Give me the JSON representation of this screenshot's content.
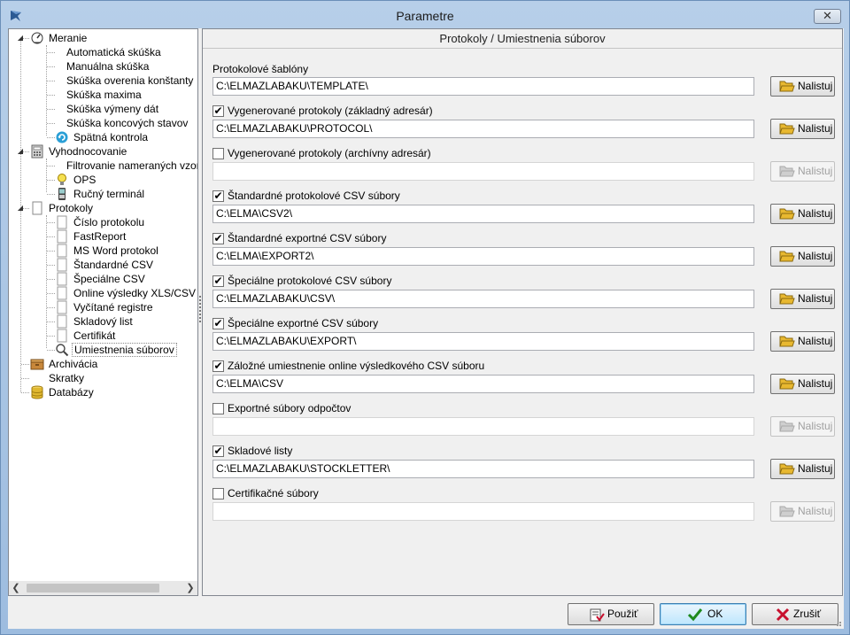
{
  "window": {
    "title": "Parametre",
    "close_label": "✕"
  },
  "tree": {
    "items": [
      {
        "label": "Meranie",
        "level": 0,
        "expander": "◢",
        "icon": "gauge-icon"
      },
      {
        "label": "Automatická skúška",
        "level": 1
      },
      {
        "label": "Manuálna skúška",
        "level": 1
      },
      {
        "label": "Skúška overenia konštanty",
        "level": 1
      },
      {
        "label": "Skúška maxima",
        "level": 1
      },
      {
        "label": "Skúška výmeny dát",
        "level": 1
      },
      {
        "label": "Skúška koncových stavov",
        "level": 1
      },
      {
        "label": "Spätná kontrola",
        "level": 1,
        "icon": "refresh-icon"
      },
      {
        "label": "Vyhodnocovanie",
        "level": 0,
        "expander": "◢",
        "icon": "calculator-icon"
      },
      {
        "label": "Filtrovanie nameraných vzoriek",
        "level": 1
      },
      {
        "label": "OPS",
        "level": 1,
        "icon": "lightbulb-icon"
      },
      {
        "label": "Ručný terminál",
        "level": 1,
        "icon": "handheld-icon"
      },
      {
        "label": "Protokoly",
        "level": 0,
        "expander": "◢",
        "icon": "document-icon"
      },
      {
        "label": "Číslo protokolu",
        "level": 1,
        "icon": "page-icon"
      },
      {
        "label": "FastReport",
        "level": 1,
        "icon": "page-icon"
      },
      {
        "label": "MS Word protokol",
        "level": 1,
        "icon": "page-icon"
      },
      {
        "label": "Štandardné CSV",
        "level": 1,
        "icon": "page-icon"
      },
      {
        "label": "Špeciálne CSV",
        "level": 1,
        "icon": "page-icon"
      },
      {
        "label": "Online výsledky XLS/CSV",
        "level": 1,
        "icon": "page-icon"
      },
      {
        "label": "Vyčítané registre",
        "level": 1,
        "icon": "page-icon"
      },
      {
        "label": "Skladový list",
        "level": 1,
        "icon": "page-icon"
      },
      {
        "label": "Certifikát",
        "level": 1,
        "icon": "page-icon"
      },
      {
        "label": "Umiestnenia súborov",
        "level": 1,
        "icon": "magnifier-icon",
        "selected": true
      },
      {
        "label": "Archivácia",
        "level": 0,
        "icon": "archive-icon"
      },
      {
        "label": "Skratky",
        "level": 0
      },
      {
        "label": "Databázy",
        "level": 0,
        "icon": "database-icon"
      }
    ]
  },
  "panel": {
    "header": "Protokoly / Umiestnenia súborov",
    "browse_label": "Nalistuj",
    "sections": [
      {
        "label": "Protokolové šablóny",
        "checkbox": false,
        "value": "C:\\ELMAZLABAKU\\TEMPLATE\\",
        "enabled": true
      },
      {
        "label": "Vygenerované protokoly (základný adresár)",
        "checkbox": true,
        "checked": true,
        "value": "C:\\ELMAZLABAKU\\PROTOCOL\\",
        "enabled": true
      },
      {
        "label": "Vygenerované protokoly (archívny adresár)",
        "checkbox": true,
        "checked": false,
        "value": "",
        "enabled": false
      },
      {
        "label": "Štandardné protokolové CSV súbory",
        "checkbox": true,
        "checked": true,
        "value": "C:\\ELMA\\CSV2\\",
        "enabled": true
      },
      {
        "label": "Štandardné exportné CSV súbory",
        "checkbox": true,
        "checked": true,
        "value": "C:\\ELMA\\EXPORT2\\",
        "enabled": true
      },
      {
        "label": "Špeciálne protokolové CSV súbory",
        "checkbox": true,
        "checked": true,
        "value": "C:\\ELMAZLABAKU\\CSV\\",
        "enabled": true
      },
      {
        "label": "Špeciálne exportné CSV súbory",
        "checkbox": true,
        "checked": true,
        "value": "C:\\ELMAZLABAKU\\EXPORT\\",
        "enabled": true
      },
      {
        "label": "Záložné umiestnenie online výsledkového CSV súboru",
        "checkbox": true,
        "checked": true,
        "value": "C:\\ELMA\\CSV",
        "enabled": true
      },
      {
        "label": "Exportné súbory odpočtov",
        "checkbox": true,
        "checked": false,
        "value": "",
        "enabled": false
      },
      {
        "label": "Skladové listy",
        "checkbox": true,
        "checked": true,
        "value": "C:\\ELMAZLABAKU\\STOCKLETTER\\",
        "enabled": true
      },
      {
        "label": "Certifikačné súbory",
        "checkbox": true,
        "checked": false,
        "value": "",
        "enabled": false
      }
    ]
  },
  "footer": {
    "apply_label": "Použiť",
    "ok_label": "OK",
    "cancel_label": "Zrušiť"
  },
  "colors": {
    "ok_check": "#1e8a1e",
    "cancel_x": "#c8102e",
    "folder": "#e8b830"
  }
}
